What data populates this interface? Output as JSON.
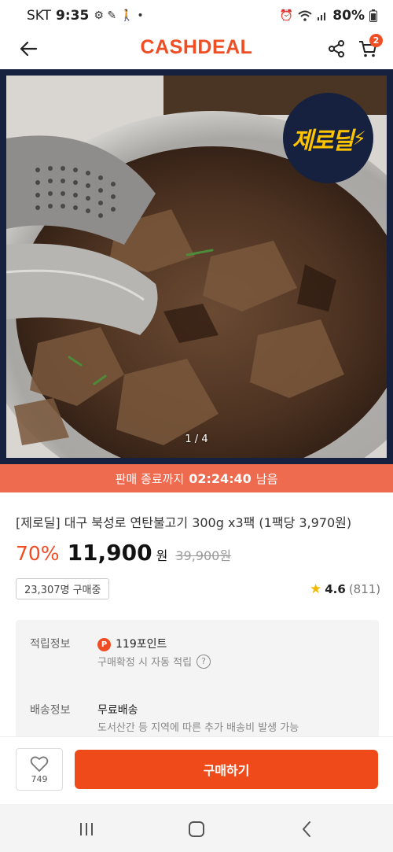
{
  "status_bar": {
    "carrier": "SKT",
    "time": "9:35",
    "battery": "80%",
    "icons": [
      "notification-icon",
      "alarm-icon",
      "wifi-icon",
      "signal-icon",
      "battery-icon"
    ]
  },
  "header": {
    "logo": "CASHDEAL",
    "cart_count": "2"
  },
  "gallery": {
    "badge_text": "제로딜",
    "page_indicator": "1 / 4"
  },
  "timer": {
    "prefix": "판매 종료까지",
    "remaining": "02:24:40",
    "suffix": "남음"
  },
  "product": {
    "title": "[제로딜] 대구 북성로 연탄불고기 300g x3팩 (1팩당 3,970원)",
    "discount": "70%",
    "price": "11,900",
    "currency": "원",
    "original_price": "39,900원",
    "buyers": "23,307명 구매중",
    "rating": "4.6",
    "review_count": "(811)"
  },
  "info": {
    "points_label": "적립정보",
    "points_icon": "P",
    "points_value": "119포인트",
    "points_note": "구매확정 시 자동 적립",
    "shipping_label": "배송정보",
    "shipping_value": "무료배송",
    "shipping_note": "도서산간 등 지역에 따른 추가 배송비 발생 가능"
  },
  "actions": {
    "like_count": "749",
    "buy_label": "구매하기"
  },
  "colors": {
    "brand": "#ef4e25",
    "timer_bg": "#ef6b4f",
    "buy_button": "#ef4a19",
    "badge_bg": "#16213f",
    "badge_text": "#ffc400"
  }
}
